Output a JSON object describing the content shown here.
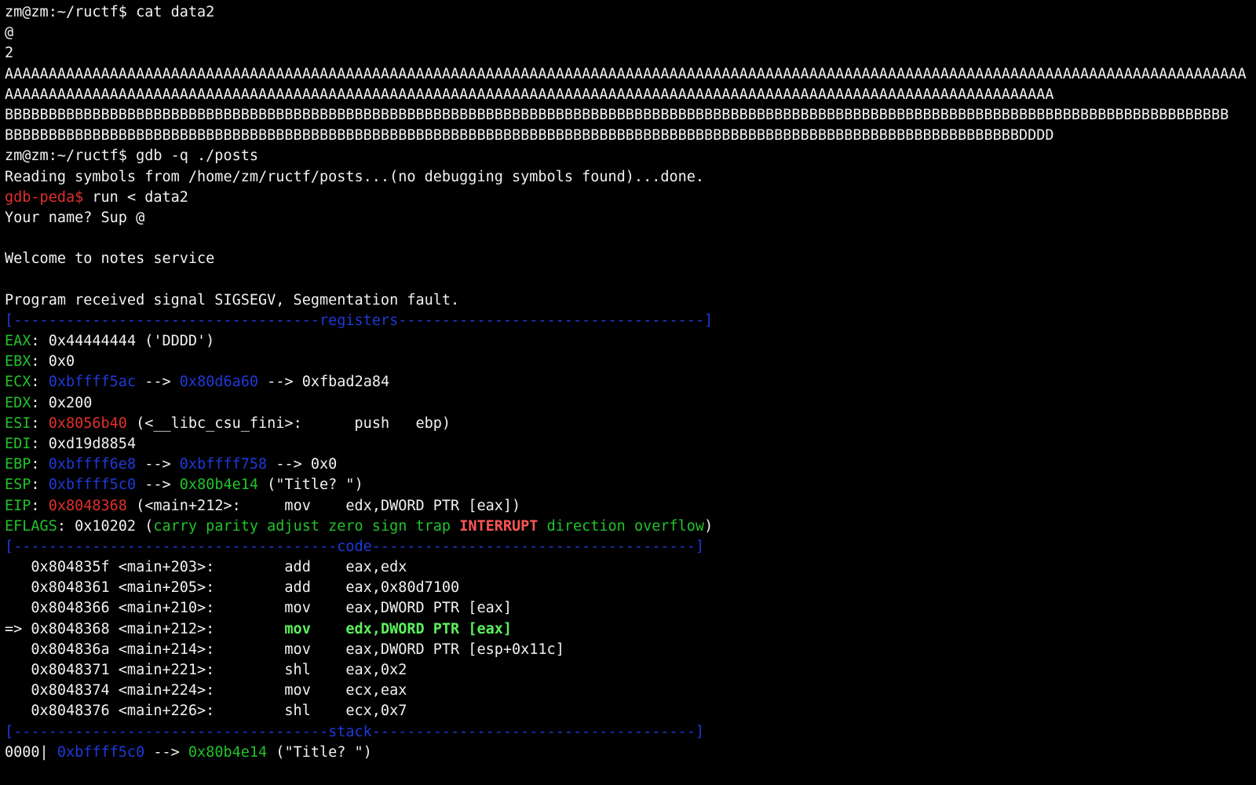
{
  "colors": {
    "background": "#000000",
    "foreground": "#f2f2f2",
    "green": "#21c22a",
    "blue": "#1f39d8",
    "red": "#e0302a",
    "bright_green": "#5cf05c",
    "bright_red": "#ff5555"
  },
  "lines": [
    [
      {
        "t": "zm@zm:~/ructf$ cat data2",
        "c": "white"
      }
    ],
    [
      {
        "t": "@",
        "c": "white"
      }
    ],
    [
      {
        "t": "2",
        "c": "white"
      }
    ],
    [
      {
        "t": "AAAAAAAAAAAAAAAAAAAAAAAAAAAAAAAAAAAAAAAAAAAAAAAAAAAAAAAAAAAAAAAAAAAAAAAAAAAAAAAAAAAAAAAAAAAAAAAAAAAAAAAAAAAAAAAAAAAAAAAAAAAAAAAAAAAAAAAAAAAAAA",
        "c": "white"
      }
    ],
    [
      {
        "t": "AAAAAAAAAAAAAAAAAAAAAAAAAAAAAAAAAAAAAAAAAAAAAAAAAAAAAAAAAAAAAAAAAAAAAAAAAAAAAAAAAAAAAAAAAAAAAAAAAAAAAAAAAAAAAAAAAAAAAAAA",
        "c": "white"
      }
    ],
    [
      {
        "t": "BBBBBBBBBBBBBBBBBBBBBBBBBBBBBBBBBBBBBBBBBBBBBBBBBBBBBBBBBBBBBBBBBBBBBBBBBBBBBBBBBBBBBBBBBBBBBBBBBBBBBBBBBBBBBBBBBBBBBBBBBBBBBBBBBBBBBBBBBBBB",
        "c": "white"
      }
    ],
    [
      {
        "t": "BBBBBBBBBBBBBBBBBBBBBBBBBBBBBBBBBBBBBBBBBBBBBBBBBBBBBBBBBBBBBBBBBBBBBBBBBBBBBBBBBBBBBBBBBBBBBBBBBBBBBBBBBBBBBBBBBBBBDDDD",
        "c": "white"
      }
    ],
    [
      {
        "t": "zm@zm:~/ructf$ gdb -q ./posts",
        "c": "white"
      }
    ],
    [
      {
        "t": "Reading symbols from /home/zm/ructf/posts...(no debugging symbols found)...done.",
        "c": "white"
      }
    ],
    [
      {
        "t": "gdb-peda$",
        "c": "red"
      },
      {
        "t": " run < data2",
        "c": "white"
      }
    ],
    [
      {
        "t": "Your name? Sup @",
        "c": "white"
      }
    ],
    [
      {
        "t": "",
        "c": "white"
      }
    ],
    [
      {
        "t": "Welcome to notes service",
        "c": "white"
      }
    ],
    [
      {
        "t": "",
        "c": "white"
      }
    ],
    [
      {
        "t": "Program received signal SIGSEGV, Segmentation fault.",
        "c": "white"
      }
    ],
    [
      {
        "t": "[-----------------------------------registers-----------------------------------]",
        "c": "blue"
      }
    ],
    [
      {
        "t": "EAX",
        "c": "green"
      },
      {
        "t": ": 0x44444444 ('DDDD')",
        "c": "white"
      }
    ],
    [
      {
        "t": "EBX",
        "c": "green"
      },
      {
        "t": ": 0x0",
        "c": "white"
      }
    ],
    [
      {
        "t": "ECX",
        "c": "green"
      },
      {
        "t": ": ",
        "c": "white"
      },
      {
        "t": "0xbffff5ac",
        "c": "blue"
      },
      {
        "t": " --> ",
        "c": "white"
      },
      {
        "t": "0x80d6a60",
        "c": "blue"
      },
      {
        "t": " --> 0xfbad2a84",
        "c": "white"
      }
    ],
    [
      {
        "t": "EDX",
        "c": "green"
      },
      {
        "t": ": 0x200",
        "c": "white"
      }
    ],
    [
      {
        "t": "ESI",
        "c": "green"
      },
      {
        "t": ": ",
        "c": "white"
      },
      {
        "t": "0x8056b40",
        "c": "red"
      },
      {
        "t": " (<__libc_csu_fini>:      push   ebp)",
        "c": "white"
      }
    ],
    [
      {
        "t": "EDI",
        "c": "green"
      },
      {
        "t": ": 0xd19d8854",
        "c": "white"
      }
    ],
    [
      {
        "t": "EBP",
        "c": "green"
      },
      {
        "t": ": ",
        "c": "white"
      },
      {
        "t": "0xbffff6e8",
        "c": "blue"
      },
      {
        "t": " --> ",
        "c": "white"
      },
      {
        "t": "0xbffff758",
        "c": "blue"
      },
      {
        "t": " --> 0x0",
        "c": "white"
      }
    ],
    [
      {
        "t": "ESP",
        "c": "green"
      },
      {
        "t": ": ",
        "c": "white"
      },
      {
        "t": "0xbffff5c0",
        "c": "blue"
      },
      {
        "t": " --> ",
        "c": "white"
      },
      {
        "t": "0x80b4e14",
        "c": "green"
      },
      {
        "t": " (\"Title? \")",
        "c": "white"
      }
    ],
    [
      {
        "t": "EIP",
        "c": "green"
      },
      {
        "t": ": ",
        "c": "white"
      },
      {
        "t": "0x8048368",
        "c": "red"
      },
      {
        "t": " (<main+212>:     mov    edx,DWORD PTR [eax])",
        "c": "white"
      }
    ],
    [
      {
        "t": "EFLAGS",
        "c": "green"
      },
      {
        "t": ": 0x10202 (",
        "c": "white"
      },
      {
        "t": "carry parity adjust zero sign trap ",
        "c": "green"
      },
      {
        "t": "INTERRUPT",
        "c": "bred"
      },
      {
        "t": " direction overflow",
        "c": "green"
      },
      {
        "t": ")",
        "c": "white"
      }
    ],
    [
      {
        "t": "[-------------------------------------code-------------------------------------]",
        "c": "blue"
      }
    ],
    [
      {
        "t": "   0x804835f <main+203>:        add    eax,edx",
        "c": "white"
      }
    ],
    [
      {
        "t": "   0x8048361 <main+205>:        add    eax,0x80d7100",
        "c": "white"
      }
    ],
    [
      {
        "t": "   0x8048366 <main+210>:        mov    eax,DWORD PTR [eax]",
        "c": "white"
      }
    ],
    [
      {
        "t": "=> 0x8048368 <main+212>:        ",
        "c": "white"
      },
      {
        "t": "mov    edx,DWORD PTR [eax]",
        "c": "bgreen"
      }
    ],
    [
      {
        "t": "   0x804836a <main+214>:        mov    eax,DWORD PTR [esp+0x11c]",
        "c": "white"
      }
    ],
    [
      {
        "t": "   0x8048371 <main+221>:        shl    eax,0x2",
        "c": "white"
      }
    ],
    [
      {
        "t": "   0x8048374 <main+224>:        mov    ecx,eax",
        "c": "white"
      }
    ],
    [
      {
        "t": "   0x8048376 <main+226>:        shl    ecx,0x7",
        "c": "white"
      }
    ],
    [
      {
        "t": "[------------------------------------stack-------------------------------------]",
        "c": "blue"
      }
    ],
    [
      {
        "t": "0000| ",
        "c": "white"
      },
      {
        "t": "0xbffff5c0",
        "c": "blue"
      },
      {
        "t": " --> ",
        "c": "white"
      },
      {
        "t": "0x80b4e14",
        "c": "green"
      },
      {
        "t": " (\"Title? \")",
        "c": "white"
      }
    ]
  ]
}
